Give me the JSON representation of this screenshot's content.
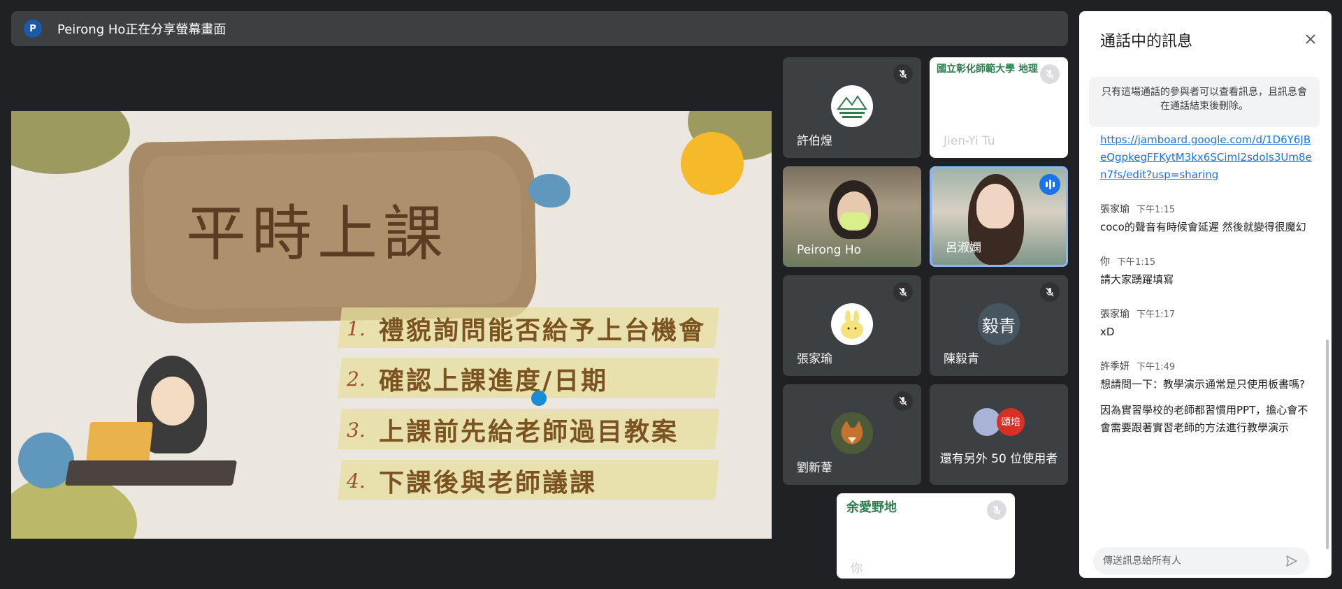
{
  "banner": {
    "avatar_letter": "P",
    "text": "Peirong Ho正在分享螢幕畫面"
  },
  "slide": {
    "title": "平時上課",
    "items": [
      {
        "num": "1.",
        "text": "禮貌詢問能否給予上台機會"
      },
      {
        "num": "2.",
        "text": "確認上課進度/日期"
      },
      {
        "num": "3.",
        "text": "上課前先給老師過目教案"
      },
      {
        "num": "4.",
        "text": "下課後與老師議課"
      }
    ]
  },
  "tiles": {
    "t1": {
      "name": "許伯煌"
    },
    "t2": {
      "name": "Jien-Yi Tu",
      "logo_text": "國立彰化師範大學 地理"
    },
    "t3": {
      "name": "Peirong Ho"
    },
    "t4": {
      "name": "呂淑嫻"
    },
    "t5": {
      "name": "張家瑜"
    },
    "t6": {
      "name": "陳毅青",
      "avatar_text": "毅青"
    },
    "t7": {
      "name": "劉新葦"
    },
    "t8": {
      "avatar_text": "頌培",
      "text": "還有另外 50 位使用者"
    },
    "t9": {
      "name": "你",
      "logo_text": "余愛野地"
    }
  },
  "chat": {
    "title": "通話中的訊息",
    "notice": "只有這場通話的參與者可以查看訊息，且訊息會在通話結束後刪除。",
    "link": "https://jamboard.google.com/d/1D6Y6JBeQgpkegFFKytM3kx6SCimI2sdoIs3Um8en7fs/edit?usp=sharing",
    "messages": [
      {
        "sender": "張家瑜",
        "time": "下午1:15",
        "text": "coco的聲音有時候會延遲 然後就變得很魔幻",
        "text2": ""
      },
      {
        "sender": "你",
        "time": "下午1:15",
        "text": "請大家踴躍填寫",
        "text2": ""
      },
      {
        "sender": "張家瑜",
        "time": "下午1:17",
        "text": "xD",
        "text2": ""
      },
      {
        "sender": "許季妍",
        "time": "下午1:49",
        "text": "想請問一下：教學演示通常是只使用板書嗎?",
        "text2": "因為實習學校的老師都習慣用PPT，擔心會不會需要跟著實習老師的方法進行教學演示"
      }
    ],
    "compose_placeholder": "傳送訊息給所有人"
  },
  "colors": {
    "accent": "#1a73e8",
    "bg": "#202124",
    "tile": "#3c4043"
  }
}
